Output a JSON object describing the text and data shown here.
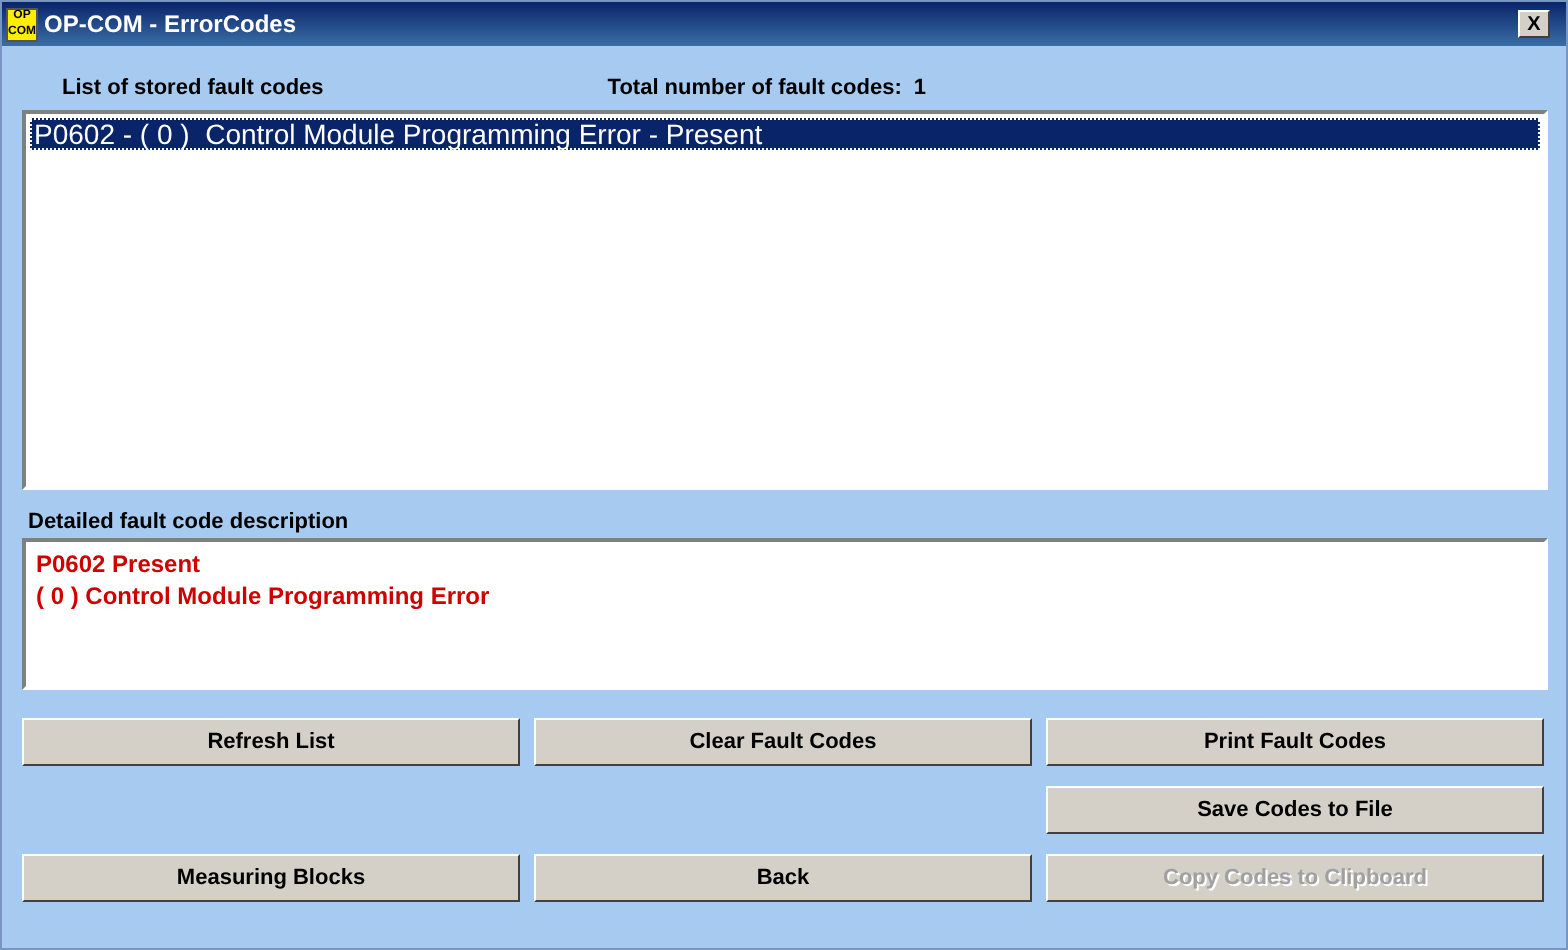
{
  "window": {
    "app_icon": "OP COM",
    "title": "OP-COM - ErrorCodes",
    "close": "X"
  },
  "list_label": "List of stored fault codes",
  "total_label": "Total number of fault codes:",
  "total_value": "1",
  "fault_codes": [
    {
      "text": "P0602 - ( 0 )  Control Module Programming Error - Present",
      "selected": true
    }
  ],
  "description_label": "Detailed fault code description",
  "description_lines": [
    "P0602  Present",
    "( 0 )  Control Module Programming Error"
  ],
  "buttons": [
    {
      "label": "Refresh List",
      "disabled": false
    },
    {
      "label": "Clear Fault Codes",
      "disabled": false
    },
    {
      "label": "Print Fault Codes",
      "disabled": false
    },
    {
      "kind": "empty"
    },
    {
      "kind": "empty"
    },
    {
      "label": "Save Codes to File",
      "disabled": false
    },
    {
      "label": "Measuring Blocks",
      "disabled": false
    },
    {
      "label": "Back",
      "disabled": false
    },
    {
      "label": "Copy Codes to Clipboard",
      "disabled": true
    }
  ]
}
